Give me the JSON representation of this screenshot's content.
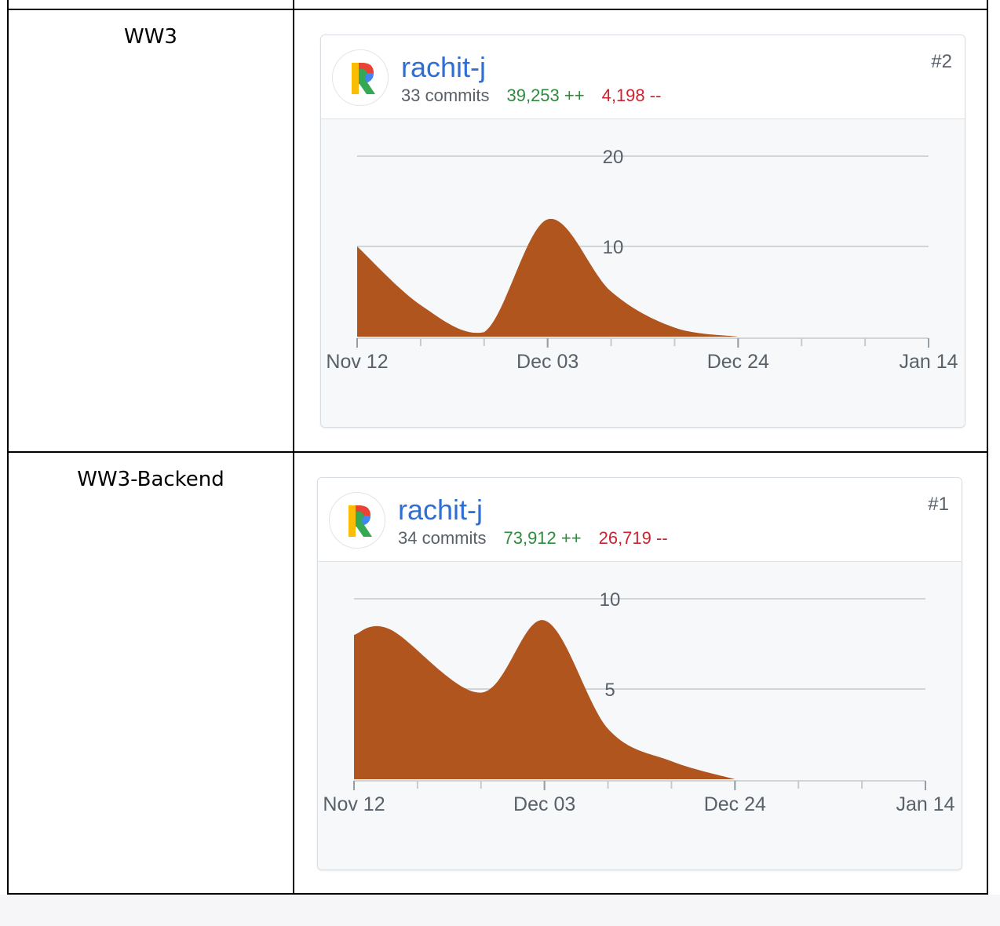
{
  "rows": [
    {
      "project": "WW3",
      "contributor": {
        "username": "rachit-j",
        "commits": "33 commits",
        "additions": "39,253 ++",
        "deletions": "4,198 --",
        "rank": "#2",
        "avatar_icon": "google-style-r-logo-icon"
      },
      "chart_data": {
        "type": "area",
        "x_ticks": [
          "Nov 12",
          "Dec 03",
          "Dec 24",
          "Jan 14"
        ],
        "y_ticks": [
          10,
          20
        ],
        "ylim": [
          0,
          20
        ],
        "color": "#b1551f",
        "x": [
          "Nov 12",
          "Nov 19",
          "Nov 26",
          "Dec 03",
          "Dec 10",
          "Dec 17",
          "Dec 24"
        ],
        "values": [
          10,
          3.5,
          0.5,
          13,
          5,
          1,
          0
        ]
      }
    },
    {
      "project": "WW3-Backend",
      "contributor": {
        "username": "rachit-j",
        "commits": "34 commits",
        "additions": "73,912 ++",
        "deletions": "26,719 --",
        "rank": "#1",
        "avatar_icon": "google-style-r-logo-icon"
      },
      "chart_data": {
        "type": "area",
        "x_ticks": [
          "Nov 12",
          "Dec 03",
          "Dec 24",
          "Jan 14"
        ],
        "y_ticks": [
          5,
          10
        ],
        "ylim": [
          0,
          10
        ],
        "color": "#b1551f",
        "x": [
          "Nov 12",
          "Nov 16",
          "Nov 26",
          "Dec 03",
          "Dec 10",
          "Dec 17",
          "Dec 24"
        ],
        "values": [
          8,
          8.3,
          4.8,
          8.8,
          2.8,
          1.0,
          0
        ]
      }
    }
  ]
}
